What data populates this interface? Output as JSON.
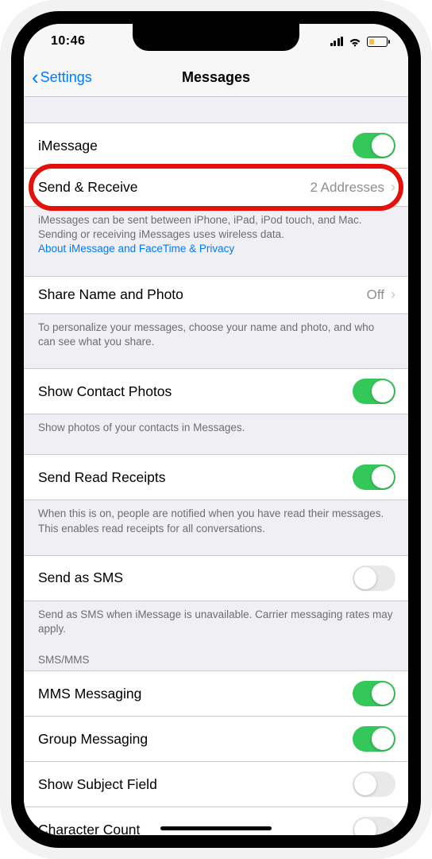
{
  "statusBar": {
    "time": "10:46"
  },
  "nav": {
    "back": "Settings",
    "title": "Messages"
  },
  "cells": {
    "imessage": {
      "label": "iMessage",
      "toggle": true
    },
    "sendReceive": {
      "label": "Send & Receive",
      "value": "2 Addresses"
    },
    "sendReceiveFooter": "iMessages can be sent between iPhone, iPad, iPod touch, and Mac. Sending or receiving iMessages uses wireless data.",
    "sendReceiveLink": "About iMessage and FaceTime & Privacy",
    "shareName": {
      "label": "Share Name and Photo",
      "value": "Off"
    },
    "shareNameFooter": "To personalize your messages, choose your name and photo, and who can see what you share.",
    "showContactPhotos": {
      "label": "Show Contact Photos",
      "toggle": true
    },
    "showContactPhotosFooter": "Show photos of your contacts in Messages.",
    "sendReadReceipts": {
      "label": "Send Read Receipts",
      "toggle": true
    },
    "sendReadReceiptsFooter": "When this is on, people are notified when you have read their messages. This enables read receipts for all conversations.",
    "sendAsSMS": {
      "label": "Send as SMS",
      "toggle": false
    },
    "sendAsSMSFooter": "Send as SMS when iMessage is unavailable. Carrier messaging rates may apply.",
    "smsHeader": "SMS/MMS",
    "mmsMessaging": {
      "label": "MMS Messaging",
      "toggle": true
    },
    "groupMessaging": {
      "label": "Group Messaging",
      "toggle": true
    },
    "showSubjectField": {
      "label": "Show Subject Field",
      "toggle": false
    },
    "characterCount": {
      "label": "Character Count",
      "toggle": false
    }
  }
}
